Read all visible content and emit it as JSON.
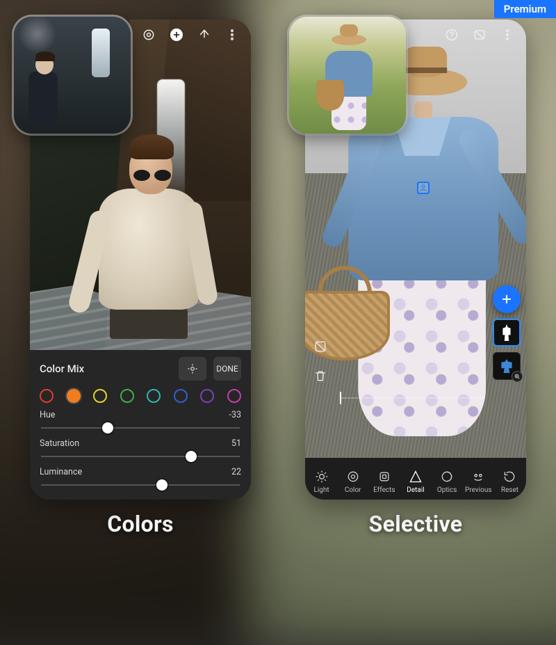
{
  "badges": {
    "premium": "Premium"
  },
  "captions": {
    "left": "Colors",
    "right": "Selective"
  },
  "phone1": {
    "topbar": {
      "undo_icon": "undo-icon",
      "view_icon": "view-original-icon",
      "add_icon": "add-icon",
      "share_icon": "share-icon",
      "menu_icon": "more-icon"
    },
    "panel": {
      "title": "Color Mix",
      "target_icon": "target-adjust-icon",
      "done_label": "DONE",
      "swatches": [
        {
          "name": "red",
          "color": "#e23b2e",
          "active": false
        },
        {
          "name": "orange",
          "color": "#f07d1f",
          "active": true
        },
        {
          "name": "yellow",
          "color": "#e9d227",
          "active": false
        },
        {
          "name": "green",
          "color": "#3fae4c",
          "active": false
        },
        {
          "name": "aqua",
          "color": "#2fb6b1",
          "active": false
        },
        {
          "name": "blue",
          "color": "#2f5fd1",
          "active": false
        },
        {
          "name": "purple",
          "color": "#7b3fb8",
          "active": false
        },
        {
          "name": "magenta",
          "color": "#c23fa8",
          "active": false
        }
      ],
      "sliders": {
        "hue": {
          "label": "Hue",
          "value": "-33",
          "pos": 0.335
        },
        "saturation": {
          "label": "Saturation",
          "value": "51",
          "pos": 0.755
        },
        "luminance": {
          "label": "Luminance",
          "value": "22",
          "pos": 0.61
        }
      }
    }
  },
  "phone2": {
    "topbar": {
      "help_icon": "help-icon",
      "compare_icon": "compare-icon",
      "menu_icon": "more-icon"
    },
    "selection_marker": "person-selection-marker",
    "side": {
      "add": "add-mask-button",
      "mask_person_a": "mask-thumb-a",
      "mask_person_b": "mask-thumb-b",
      "zoom": "mask-zoom-button"
    },
    "left_icons": {
      "invert": "invert-mask-icon",
      "delete": "delete-mask-icon"
    },
    "toolbar": [
      {
        "name": "light",
        "label": "Light",
        "active": false
      },
      {
        "name": "color",
        "label": "Color",
        "active": false
      },
      {
        "name": "effects",
        "label": "Effects",
        "active": false
      },
      {
        "name": "detail",
        "label": "Detail",
        "active": true
      },
      {
        "name": "optics",
        "label": "Optics",
        "active": false
      },
      {
        "name": "previous",
        "label": "Previous",
        "active": false
      },
      {
        "name": "reset",
        "label": "Reset",
        "active": false
      }
    ]
  }
}
